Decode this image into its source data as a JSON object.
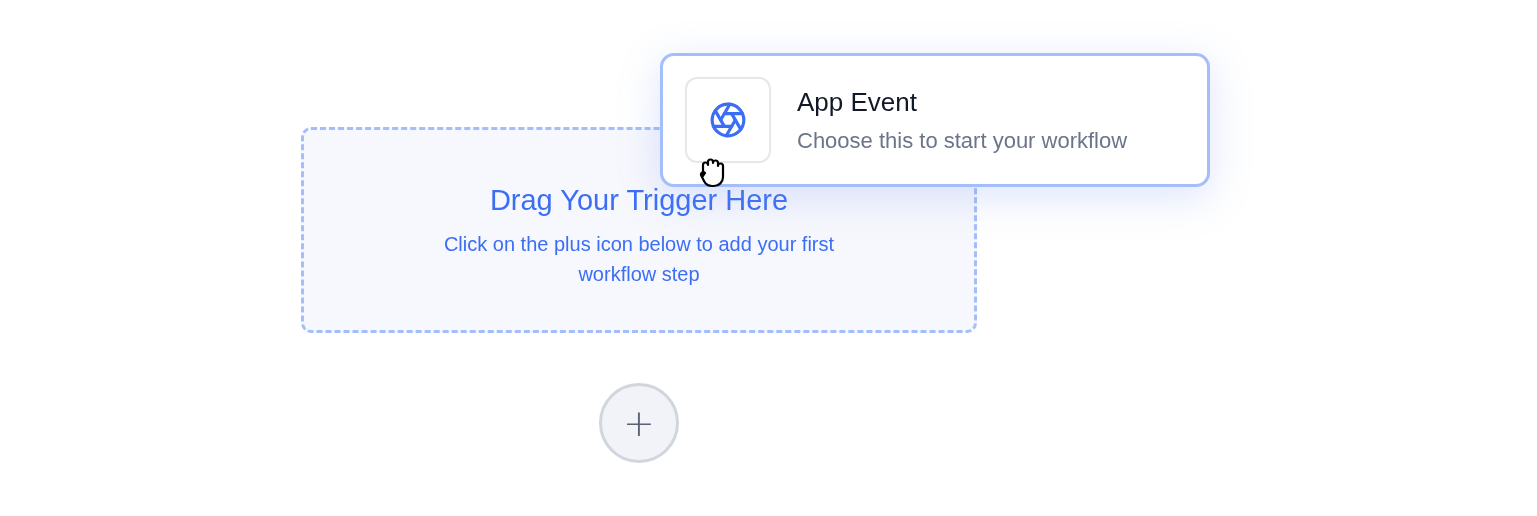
{
  "drop_zone": {
    "title": "Drag Your Trigger Here",
    "description": "Click on the plus icon below to add your first workflow step"
  },
  "add_step_button": {
    "label": "+"
  },
  "dragged_card": {
    "title": "App Event",
    "description": "Choose this to start your workflow"
  }
}
